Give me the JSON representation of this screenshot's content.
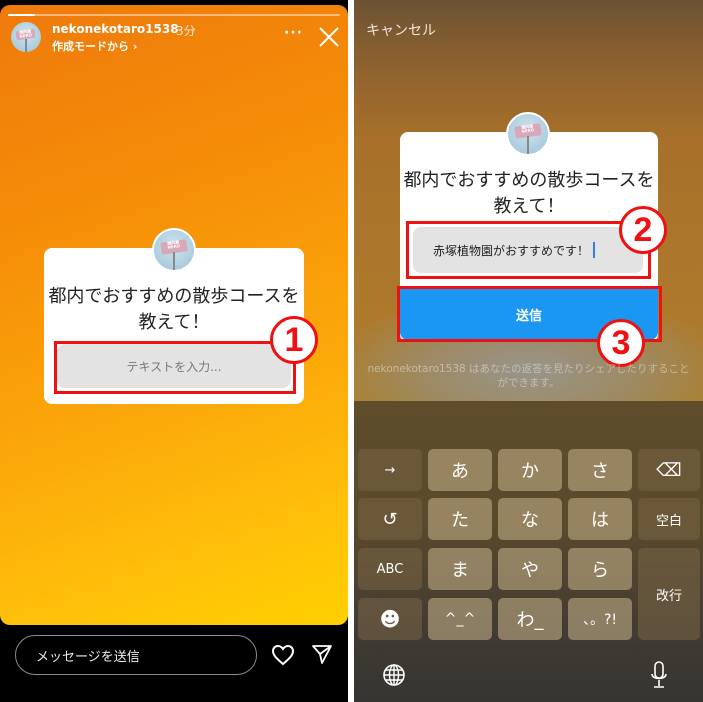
{
  "left": {
    "header": {
      "username": "nekonekotaro1538",
      "time": "3分",
      "subline": "作成モードから ›",
      "more_icon": "more-horizontal-icon",
      "close_icon": "close-icon",
      "progress": 0.08
    },
    "card": {
      "avatar_text": "謎肉屋 NEKO",
      "question": "都内でおすすめの散歩コースを教えて！",
      "input_placeholder": "テキストを入力..."
    },
    "annotation": {
      "number": "1"
    },
    "footer": {
      "message_placeholder": "メッセージを送信",
      "heart_icon": "heart-icon",
      "send_icon": "send-icon"
    }
  },
  "right": {
    "cancel_label": "キャンセル",
    "card": {
      "avatar_text": "謎肉屋 NEKO",
      "question": "都内でおすすめの散歩コースを教えて！",
      "input_value": "赤塚植物園がおすすめです！",
      "submit_label": "送信"
    },
    "annotations": {
      "two": "2",
      "three": "3"
    },
    "notice": "nekonekotaro1538 はあなたの返答を見たりシェアしたりすることができます。",
    "keyboard": {
      "rows": [
        [
          {
            "label": "→",
            "type": "dark"
          },
          {
            "label": "あ",
            "type": "light"
          },
          {
            "label": "か",
            "type": "light"
          },
          {
            "label": "さ",
            "type": "light"
          },
          {
            "label": "⌫",
            "type": "dark",
            "icon": "backspace-icon"
          }
        ],
        [
          {
            "label": "↺",
            "type": "dark",
            "icon": "undo-icon"
          },
          {
            "label": "た",
            "type": "light"
          },
          {
            "label": "な",
            "type": "light"
          },
          {
            "label": "は",
            "type": "light"
          },
          {
            "label": "空白",
            "type": "dark"
          }
        ],
        [
          {
            "label": "ABC",
            "type": "dark"
          },
          {
            "label": "ま",
            "type": "light"
          },
          {
            "label": "や",
            "type": "light"
          },
          {
            "label": "ら",
            "type": "light"
          }
        ],
        [
          {
            "label": "☻",
            "type": "dark",
            "icon": "emoji-icon"
          },
          {
            "label": "^_^",
            "type": "light"
          },
          {
            "label": "わ_",
            "type": "light"
          },
          {
            "label": "、。?!",
            "type": "light"
          }
        ]
      ],
      "return_label": "改行",
      "globe_icon": "globe-icon",
      "mic_icon": "microphone-icon"
    }
  }
}
